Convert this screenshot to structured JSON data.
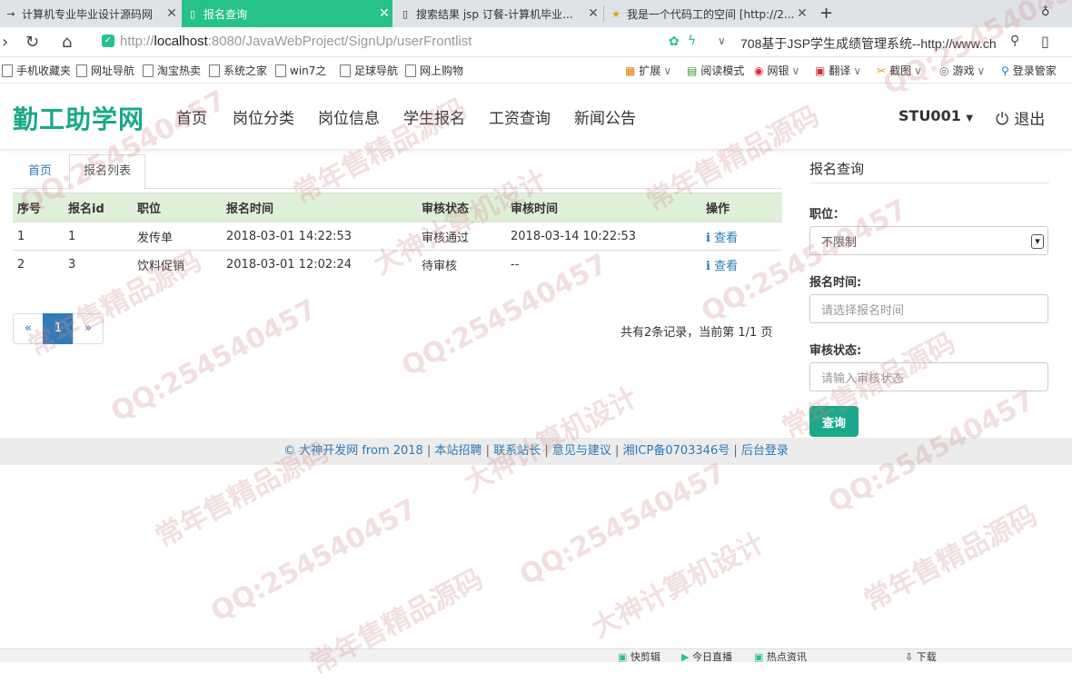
{
  "browser": {
    "tabs": [
      {
        "title": "计算机专业毕业设计源码网",
        "active": false
      },
      {
        "title": "报名查询",
        "active": true
      },
      {
        "title": "搜索结果 jsp 订餐-计算机毕业...",
        "active": false
      },
      {
        "title": "我是一个代码工的空间 [http://2...",
        "active": false
      }
    ],
    "new_tab": "+",
    "url_prefix": "http://",
    "url_host": "localhost",
    "url_path": ":8080/JavaWebProject/SignUp/userFrontlist",
    "search_box": "708基于JSP学生成绩管理系统--http://www.ch",
    "bookmarks": [
      "手机收藏夹",
      "网址导航",
      "淘宝热卖",
      "系统之家",
      "win7之",
      "足球导航",
      "网上购物"
    ],
    "toolbar_items": [
      "扩展",
      "阅读模式",
      "网银",
      "翻译",
      "截图",
      "游戏",
      "登录管家"
    ]
  },
  "site": {
    "brand": "勤工助学网",
    "nav": [
      "首页",
      "岗位分类",
      "岗位信息",
      "学生报名",
      "工资查询",
      "新闻公告"
    ],
    "user": "STU001",
    "logout": "退出"
  },
  "breadcrumb": {
    "home": "首页",
    "current": "报名列表"
  },
  "table": {
    "headers": [
      "序号",
      "报名id",
      "职位",
      "报名时间",
      "审核状态",
      "审核时间",
      "操作"
    ],
    "rows": [
      {
        "no": "1",
        "id": "1",
        "position": "发传单",
        "time": "2018-03-01 14:22:53",
        "status": "审核通过",
        "audit_time": "2018-03-14 10:22:53",
        "action": "查看"
      },
      {
        "no": "2",
        "id": "3",
        "position": "饮料促销",
        "time": "2018-03-01 12:02:24",
        "status": "待审核",
        "audit_time": "--",
        "action": "查看"
      }
    ]
  },
  "pagination": {
    "prev": "«",
    "current": "1",
    "next": "»",
    "info": "共有2条记录，当前第 1/1 页"
  },
  "search_panel": {
    "title": "报名查询",
    "position_label": "职位：",
    "position_value": "不限制",
    "time_label": "报名时间:",
    "time_placeholder": "请选择报名时间",
    "status_label": "审核状态:",
    "status_placeholder": "请输入审核状态",
    "submit": "查询"
  },
  "footer": {
    "links": [
      "© 大神开发网 from 2018",
      "本站招聘",
      "联系站长",
      "意见与建议",
      "湘ICP备0703346号",
      "后台登录"
    ]
  },
  "statusbar": [
    "快剪辑",
    "今日直播",
    "热点资讯",
    "下载"
  ],
  "watermarks": [
    "QQ:254540457",
    "大神计算机设计",
    "常年售精品源码"
  ],
  "colors": {
    "brand": "#19a98a",
    "active_tab": "#27c28a",
    "link": "#2a7ab8",
    "table_head": "#dff0d8",
    "page_active": "#337ab7"
  }
}
